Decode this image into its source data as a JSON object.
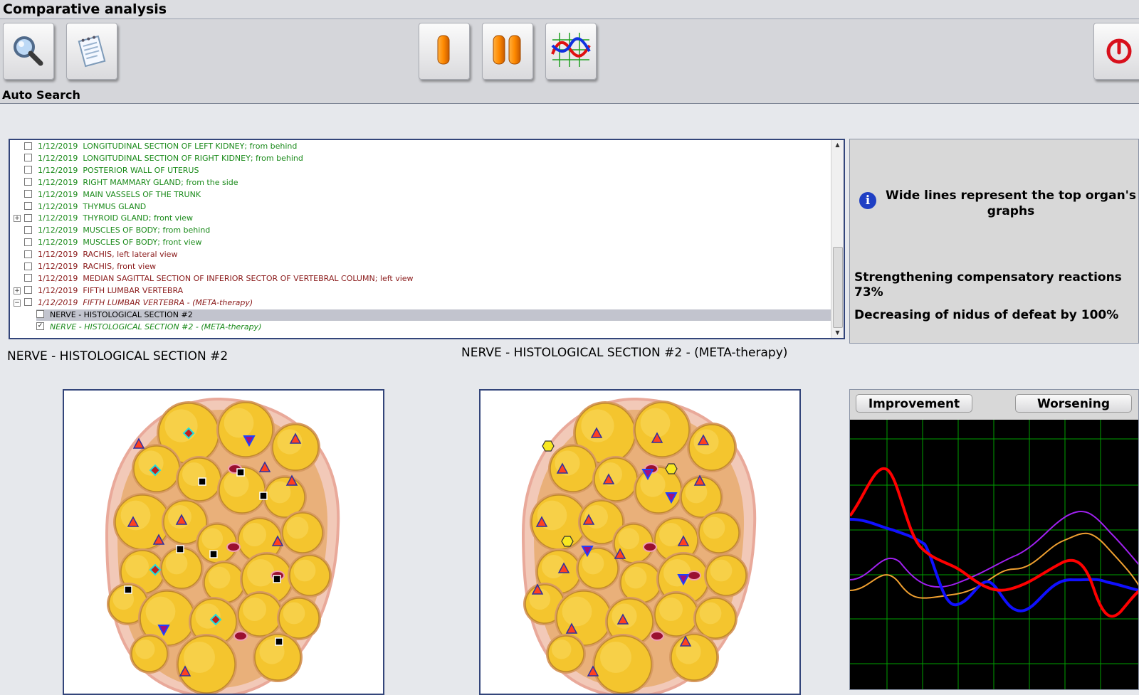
{
  "window": {
    "title": "Comparative analysis"
  },
  "toolbar": {
    "buttons": [
      {
        "name": "search-button",
        "icon": "magnifier-icon"
      },
      {
        "name": "notes-button",
        "icon": "notepad-icon"
      },
      {
        "name": "single-view-button",
        "icon": "single-capsule-icon"
      },
      {
        "name": "dual-view-button",
        "icon": "double-capsule-icon"
      },
      {
        "name": "graph-view-button",
        "icon": "graph-icon"
      },
      {
        "name": "power-button",
        "icon": "power-icon"
      }
    ],
    "auto_search_label": "Auto Search"
  },
  "list": {
    "items": [
      {
        "date": "1/12/2019",
        "text": "LONGITUDINAL  SECTION  OF  LEFT  KIDNEY; from behind",
        "color": "green",
        "checked": false
      },
      {
        "date": "1/12/2019",
        "text": "LONGITUDINAL  SECTION  OF  RIGHT  KIDNEY; from behind",
        "color": "green",
        "checked": false
      },
      {
        "date": "1/12/2019",
        "text": "POSTERIOR WALL OF UTERUS",
        "color": "green",
        "checked": false
      },
      {
        "date": "1/12/2019",
        "text": "RIGHT  MAMMARY  GLAND; from the side",
        "color": "green",
        "checked": false
      },
      {
        "date": "1/12/2019",
        "text": "MAIN  VASSELS  OF  THE  TRUNK",
        "color": "green",
        "checked": false
      },
      {
        "date": "1/12/2019",
        "text": "THYMUS GLAND",
        "color": "green",
        "checked": false
      },
      {
        "date": "1/12/2019",
        "text": "THYROID GLAND; front view",
        "color": "green",
        "checked": false
      },
      {
        "date": "1/12/2019",
        "text": "MUSCLES OF BODY; from behind",
        "color": "green",
        "checked": false
      },
      {
        "date": "1/12/2019",
        "text": "MUSCLES OF BODY; front view",
        "color": "green",
        "checked": false
      },
      {
        "date": "1/12/2019",
        "text": "RACHIS, left lateral view",
        "color": "dred",
        "checked": false
      },
      {
        "date": "1/12/2019",
        "text": "RACHIS, front view",
        "color": "dred",
        "checked": false
      },
      {
        "date": "1/12/2019",
        "text": "MEDIAN SAGITTAL SECTION OF INFERIOR SECTOR OF VERTEBRAL COLUMN; left view",
        "color": "dred",
        "checked": false
      },
      {
        "date": "1/12/2019",
        "text": "FIFTH LUMBAR VERTEBRA",
        "color": "dred",
        "checked": false
      },
      {
        "date": "1/12/2019",
        "text": "FIFTH LUMBAR VERTEBRA - (META-therapy)",
        "color": "dred",
        "checked": false
      },
      {
        "date": "",
        "text": "NERVE - HISTOLOGICAL SECTION #2",
        "color": "black",
        "checked": false
      },
      {
        "date": "",
        "text": "NERVE - HISTOLOGICAL SECTION #2 - (META-therapy)",
        "color": "green",
        "checked": true
      }
    ],
    "expanders": [
      "+",
      "+",
      "−"
    ]
  },
  "info": {
    "headline": "Wide lines represent the top organ's graphs",
    "line1": "Strengthening compensatory reactions 73%",
    "line2": "Decreasing of nidus of defeat by 100%"
  },
  "captions": {
    "left": "NERVE - HISTOLOGICAL SECTION #2",
    "right": "NERVE - HISTOLOGICAL SECTION #2 - (META-therapy)"
  },
  "graph": {
    "improvement_label": "Improvement",
    "worsening_label": "Worsening",
    "colors": {
      "red": "#ff0000",
      "blue": "#1010ff",
      "purple": "#a020f0",
      "orange": "#f0a030",
      "grid": "#00a000"
    }
  }
}
